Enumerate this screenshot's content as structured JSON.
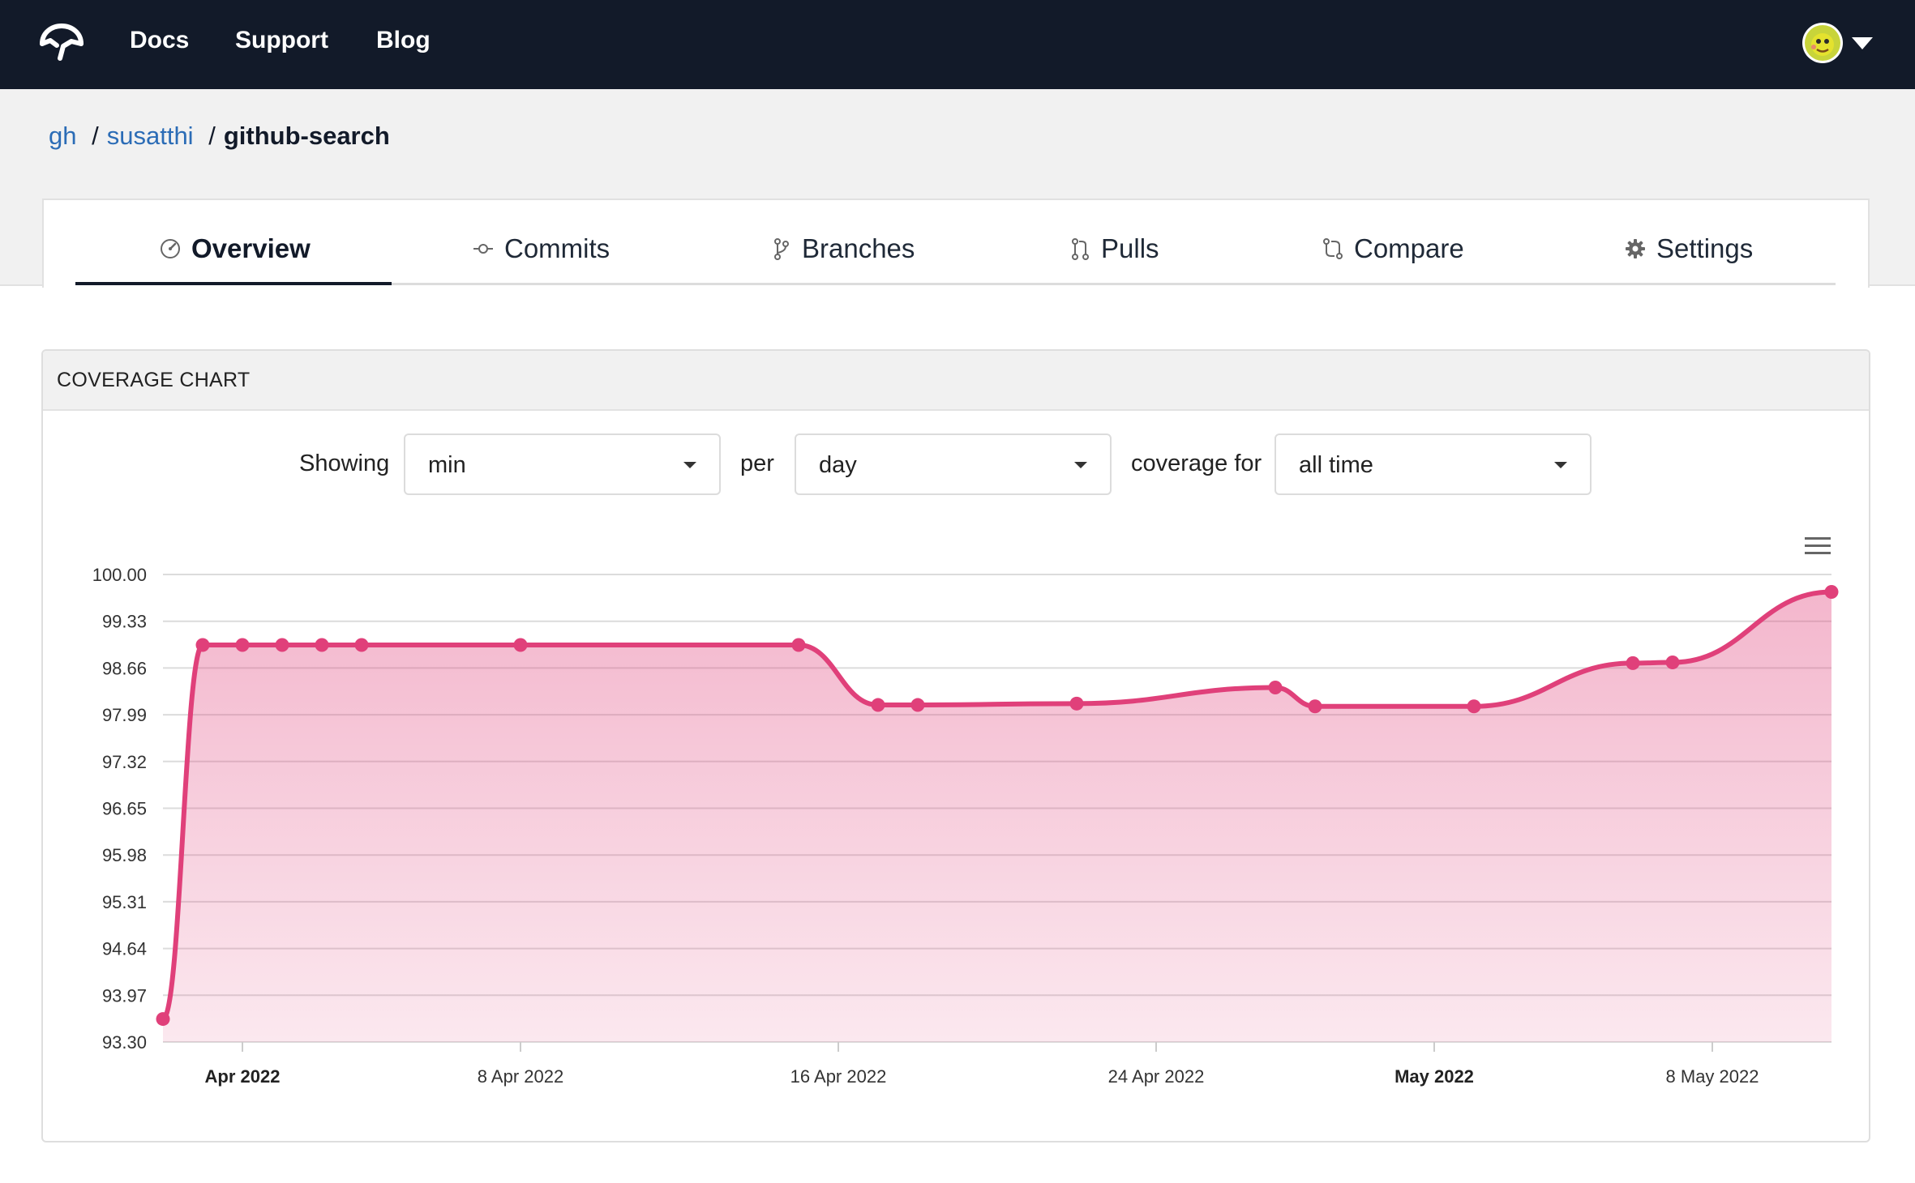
{
  "nav": {
    "links": [
      "Docs",
      "Support",
      "Blog"
    ]
  },
  "breadcrumb": {
    "items": [
      "gh",
      "susatthi"
    ],
    "current": "github-search",
    "separator": "/"
  },
  "tabs": [
    {
      "label": "Overview",
      "icon": "gauge-icon",
      "active": true
    },
    {
      "label": "Commits",
      "icon": "commit-icon",
      "active": false
    },
    {
      "label": "Branches",
      "icon": "branch-icon",
      "active": false
    },
    {
      "label": "Pulls",
      "icon": "pull-request-icon",
      "active": false
    },
    {
      "label": "Compare",
      "icon": "compare-icon",
      "active": false
    },
    {
      "label": "Settings",
      "icon": "gear-icon",
      "active": false
    }
  ],
  "chart_card": {
    "title": "COVERAGE CHART",
    "controls": {
      "showing_label": "Showing",
      "aggregate": "min",
      "per_label": "per",
      "interval": "day",
      "coverage_for_label": "coverage for",
      "range": "all time"
    }
  },
  "colors": {
    "nav_bg": "#121a29",
    "link": "#2b6cb6",
    "series": "#e0407a"
  },
  "chart_data": {
    "type": "area",
    "title": "",
    "xlabel": "",
    "ylabel": "",
    "ylim": [
      93.3,
      100.0
    ],
    "yticks": [
      "100.00",
      "99.33",
      "98.66",
      "97.99",
      "97.32",
      "96.65",
      "95.98",
      "95.31",
      "94.64",
      "93.97",
      "93.30"
    ],
    "xticks": [
      {
        "date": "2022-04-01",
        "label": "Apr 2022",
        "bold": true
      },
      {
        "date": "2022-04-08",
        "label": "8 Apr 2022",
        "bold": false
      },
      {
        "date": "2022-04-16",
        "label": "16 Apr 2022",
        "bold": false
      },
      {
        "date": "2022-04-24",
        "label": "24 Apr 2022",
        "bold": false
      },
      {
        "date": "2022-05-01",
        "label": "May 2022",
        "bold": true
      },
      {
        "date": "2022-05-08",
        "label": "8 May 2022",
        "bold": false
      }
    ],
    "xlim": [
      "2022-03-30",
      "2022-05-11"
    ],
    "grid": true,
    "series": [
      {
        "points": [
          {
            "x": "2022-03-30",
            "y": 93.63
          },
          {
            "x": "2022-03-31",
            "y": 98.99
          },
          {
            "x": "2022-04-01",
            "y": 98.99
          },
          {
            "x": "2022-04-02",
            "y": 98.99
          },
          {
            "x": "2022-04-03",
            "y": 98.99
          },
          {
            "x": "2022-04-04",
            "y": 98.99
          },
          {
            "x": "2022-04-08",
            "y": 98.99
          },
          {
            "x": "2022-04-15",
            "y": 98.99
          },
          {
            "x": "2022-04-17",
            "y": 98.13
          },
          {
            "x": "2022-04-18",
            "y": 98.13
          },
          {
            "x": "2022-04-22",
            "y": 98.15
          },
          {
            "x": "2022-04-27",
            "y": 98.38
          },
          {
            "x": "2022-04-28",
            "y": 98.11
          },
          {
            "x": "2022-05-02",
            "y": 98.11
          },
          {
            "x": "2022-05-06",
            "y": 98.73
          },
          {
            "x": "2022-05-07",
            "y": 98.74
          },
          {
            "x": "2022-05-11",
            "y": 99.75
          }
        ]
      }
    ]
  }
}
